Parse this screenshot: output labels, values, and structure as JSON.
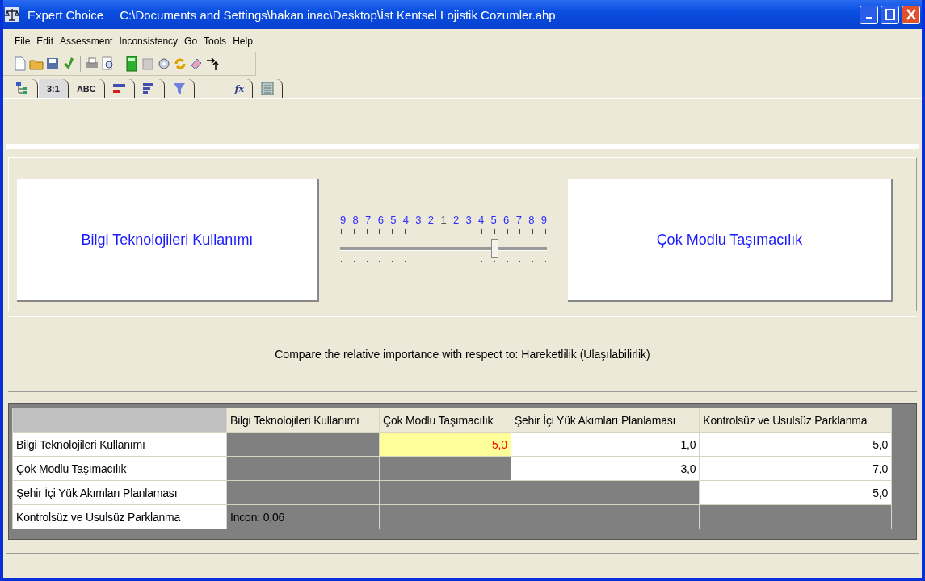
{
  "window": {
    "title": "Expert Choice",
    "path": "C:\\Documents and Settings\\hakan.inac\\Desktop\\İst Kentsel Lojistik Cozumler.ahp"
  },
  "menu": [
    "File",
    "Edit",
    "Assessment",
    "Inconsistency",
    "Go",
    "Tools",
    "Help"
  ],
  "tabs": [
    {
      "kind": "tree",
      "selected": false
    },
    {
      "kind": "text",
      "label": "3:1",
      "selected": true
    },
    {
      "kind": "text",
      "label": "ABC",
      "selected": false
    },
    {
      "kind": "bars-red",
      "selected": false
    },
    {
      "kind": "bars",
      "selected": false
    },
    {
      "kind": "funnel",
      "selected": false
    },
    {
      "kind": "gap"
    },
    {
      "kind": "italic",
      "label": "fx",
      "selected": false
    },
    {
      "kind": "grid",
      "selected": false
    }
  ],
  "comparison": {
    "left": "Bilgi Teknolojileri Kullanımı",
    "right": "Çok Modlu Taşımacılık",
    "scale": [
      "9",
      "8",
      "7",
      "6",
      "5",
      "4",
      "3",
      "2",
      "1",
      "2",
      "3",
      "4",
      "5",
      "6",
      "7",
      "8",
      "9"
    ],
    "slider": {
      "level": 0.75
    },
    "prompt": "Compare the relative importance with respect to: Hareketlilik (Ulaşılabilirlik)"
  },
  "table": {
    "columns": [
      "Bilgi Teknolojileri Kullanımı",
      "Çok Modlu Taşımacılık",
      "Şehir İçi Yük Akımları Planlaması",
      "Kontrolsüz ve Usulsüz Parklanma"
    ],
    "rows": [
      {
        "label": "Bilgi Teknolojileri Kullanımı",
        "cells": [
          {
            "kind": "blank"
          },
          {
            "kind": "current",
            "text": "5,0"
          },
          {
            "kind": "value",
            "text": "1,0"
          },
          {
            "kind": "value",
            "text": "5,0"
          }
        ]
      },
      {
        "label": "Çok Modlu Taşımacılık",
        "cells": [
          {
            "kind": "blank"
          },
          {
            "kind": "blank"
          },
          {
            "kind": "value",
            "text": "3,0"
          },
          {
            "kind": "value",
            "text": "7,0"
          }
        ]
      },
      {
        "label": "Şehir İçi Yük Akımları Planlaması",
        "cells": [
          {
            "kind": "blank"
          },
          {
            "kind": "blank"
          },
          {
            "kind": "blank"
          },
          {
            "kind": "value",
            "text": "5,0"
          }
        ]
      },
      {
        "label": "Kontrolsüz ve Usulsüz Parklanma",
        "cells": [
          {
            "kind": "note",
            "text": "Incon: 0,06"
          },
          {
            "kind": "blank"
          },
          {
            "kind": "blank"
          },
          {
            "kind": "blank"
          }
        ]
      }
    ]
  }
}
